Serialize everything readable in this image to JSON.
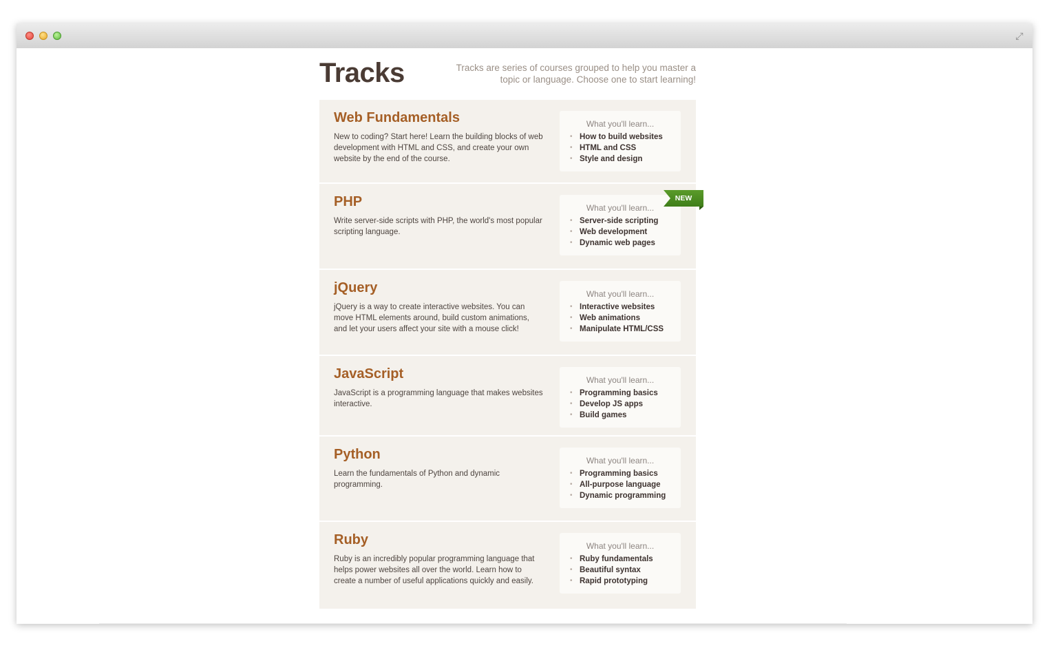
{
  "header": {
    "title": "Tracks",
    "subtitle": "Tracks are series of courses grouped to help you master a topic or language. Choose one to start learning!"
  },
  "learn_heading": "What you'll learn...",
  "badge_new": "NEW",
  "tracks": [
    {
      "name": "Web Fundamentals",
      "description": "New to coding? Start here! Learn the building blocks of web development with HTML and CSS, and create your own website by the end of the course.",
      "learn": [
        "How to build websites",
        "HTML and CSS",
        "Style and design"
      ]
    },
    {
      "name": "PHP",
      "description": "Write server-side scripts with PHP, the world's most popular scripting language.",
      "learn": [
        "Server-side scripting",
        "Web development",
        "Dynamic web pages"
      ]
    },
    {
      "name": "jQuery",
      "description": "jQuery is a way to create interactive websites. You can move HTML elements around, build custom animations, and let your users affect your site with a mouse click!",
      "learn": [
        "Interactive websites",
        "Web animations",
        "Manipulate HTML/CSS"
      ]
    },
    {
      "name": "JavaScript",
      "description": "JavaScript is a programming language that makes websites interactive.",
      "learn": [
        "Programming basics",
        "Develop JS apps",
        "Build games"
      ]
    },
    {
      "name": "Python",
      "description": "Learn the fundamentals of Python and dynamic programming.",
      "learn": [
        "Programming basics",
        "All-purpose language",
        "Dynamic programming"
      ]
    },
    {
      "name": "Ruby",
      "description": "Ruby is an incredibly popular programming language that helps power websites all over the world. Learn how to create a number of useful applications quickly and easily.",
      "learn": [
        "Ruby fundamentals",
        "Beautiful syntax",
        "Rapid prototyping"
      ]
    }
  ],
  "colors": {
    "accent": "#a55f26",
    "title": "#4a3b34",
    "card_bg": "#f4f1ec",
    "badge": "#4a8a20"
  },
  "icons": {
    "close": "close-icon",
    "minimize": "minimize-icon",
    "zoom": "zoom-icon",
    "fullscreen": "fullscreen-icon"
  }
}
